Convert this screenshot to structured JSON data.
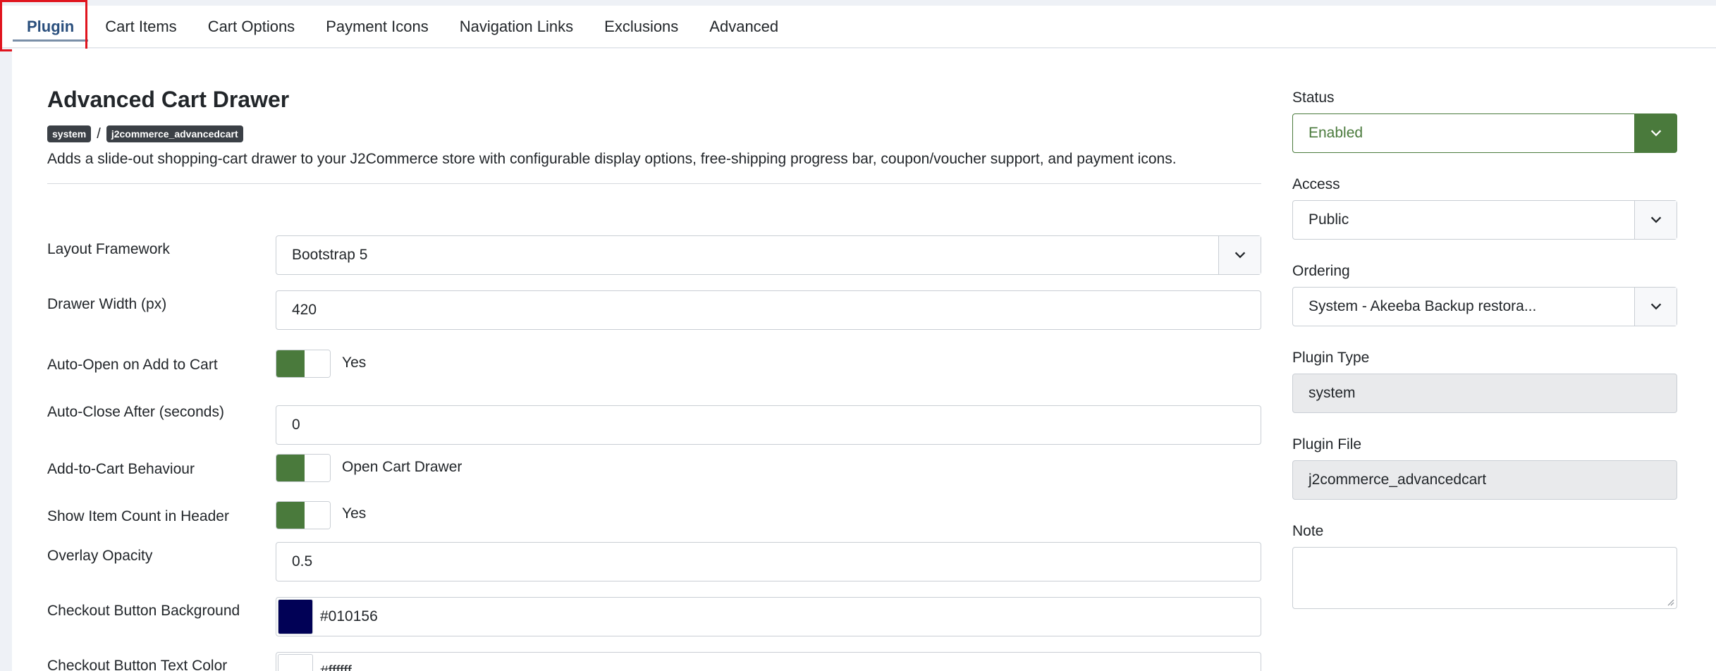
{
  "tabs": [
    {
      "label": "Plugin",
      "active": true
    },
    {
      "label": "Cart Items"
    },
    {
      "label": "Cart Options"
    },
    {
      "label": "Payment Icons"
    },
    {
      "label": "Navigation Links"
    },
    {
      "label": "Exclusions"
    },
    {
      "label": "Advanced"
    }
  ],
  "plugin": {
    "title": "Advanced Cart Drawer",
    "folder_badge": "system",
    "element_badge": "j2commerce_advancedcart",
    "separator": "/",
    "description": "Adds a slide-out shopping-cart drawer to your J2Commerce store with configurable display options, free-shipping progress bar, coupon/voucher support, and payment icons."
  },
  "form": {
    "layout_framework": {
      "label": "Layout Framework",
      "value": "Bootstrap 5"
    },
    "drawer_width": {
      "label": "Drawer Width (px)",
      "value": "420"
    },
    "auto_open": {
      "label": "Auto-Open on Add to Cart",
      "value": "Yes"
    },
    "auto_close": {
      "label": "Auto-Close After (seconds)",
      "value": "0"
    },
    "add_to_cart_behaviour": {
      "label": "Add-to-Cart Behaviour",
      "value": "Open Cart Drawer"
    },
    "show_item_count": {
      "label": "Show Item Count in Header",
      "value": "Yes"
    },
    "overlay_opacity": {
      "label": "Overlay Opacity",
      "value": "0.5"
    },
    "checkout_bg": {
      "label": "Checkout Button Background",
      "value": "#010156"
    },
    "checkout_text": {
      "label": "Checkout Button Text Color",
      "value": "#ffffff"
    }
  },
  "sidebar": {
    "status": {
      "label": "Status",
      "value": "Enabled"
    },
    "access": {
      "label": "Access",
      "value": "Public"
    },
    "ordering": {
      "label": "Ordering",
      "value": "System - Akeeba Backup restora..."
    },
    "plugin_type": {
      "label": "Plugin Type",
      "value": "system"
    },
    "plugin_file": {
      "label": "Plugin File",
      "value": "j2commerce_advancedcart"
    },
    "note": {
      "label": "Note",
      "value": ""
    }
  },
  "colors": {
    "toggle_on": "#4a7a3c",
    "active_tab": "#2a4f7d",
    "tab_highlight": "#e0141e",
    "checkout_bg_swatch": "#010156",
    "checkout_text_swatch": "#ffffff"
  },
  "icons": {
    "select_caret": "chevron-down-icon",
    "resize": "resize-grip-icon"
  }
}
